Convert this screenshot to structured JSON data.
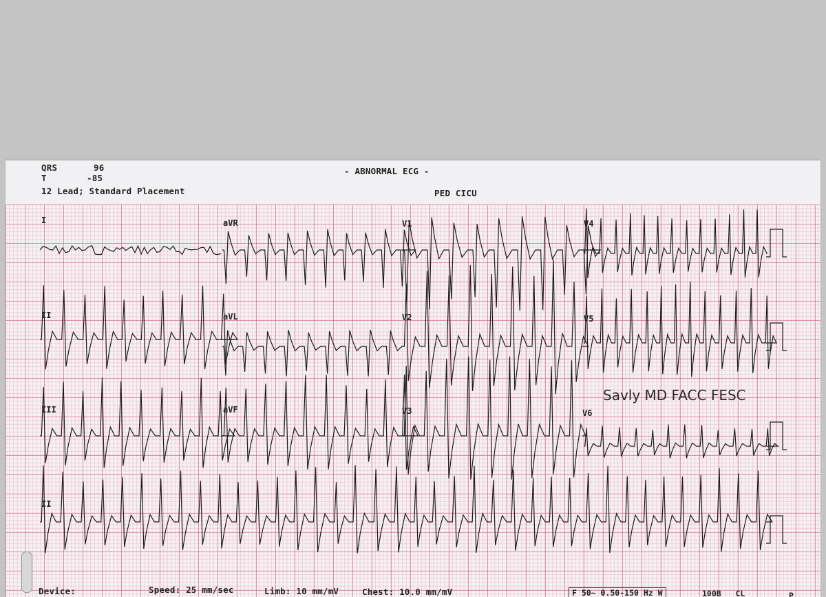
{
  "header": {
    "qrs_label": "QRS",
    "qrs_value": "96",
    "t_label": "T",
    "t_value": "-85",
    "placement": "12 Lead; Standard Placement",
    "interpretation": "- ABNORMAL ECG -",
    "location": "PED CICU"
  },
  "leads": {
    "I": "I",
    "aVR": "aVR",
    "V1": "V1",
    "V4": "V4",
    "II": "II",
    "aVL": "aVL",
    "V2": "V2",
    "V5": "V5",
    "III": "III",
    "aVF": "aVF",
    "V3": "V3",
    "V6": "V6",
    "rhythm": "II"
  },
  "signature": "Savly MD FACC FESC",
  "footer": {
    "device": "Device:",
    "speed": "Speed: 25 mm/sec",
    "limb": "Limb: 10 mm/mV",
    "chest": "Chest: 10.0 mm/mV",
    "filter": "F 50~ 0.50-150 Hz W",
    "model": "100B   CL",
    "trailing": "P"
  },
  "colors": {
    "paper": "#f6f1f3",
    "grid_major": "#cd5a78",
    "grid_minor": "#e196aa",
    "trace": "#1c1c1c"
  }
}
